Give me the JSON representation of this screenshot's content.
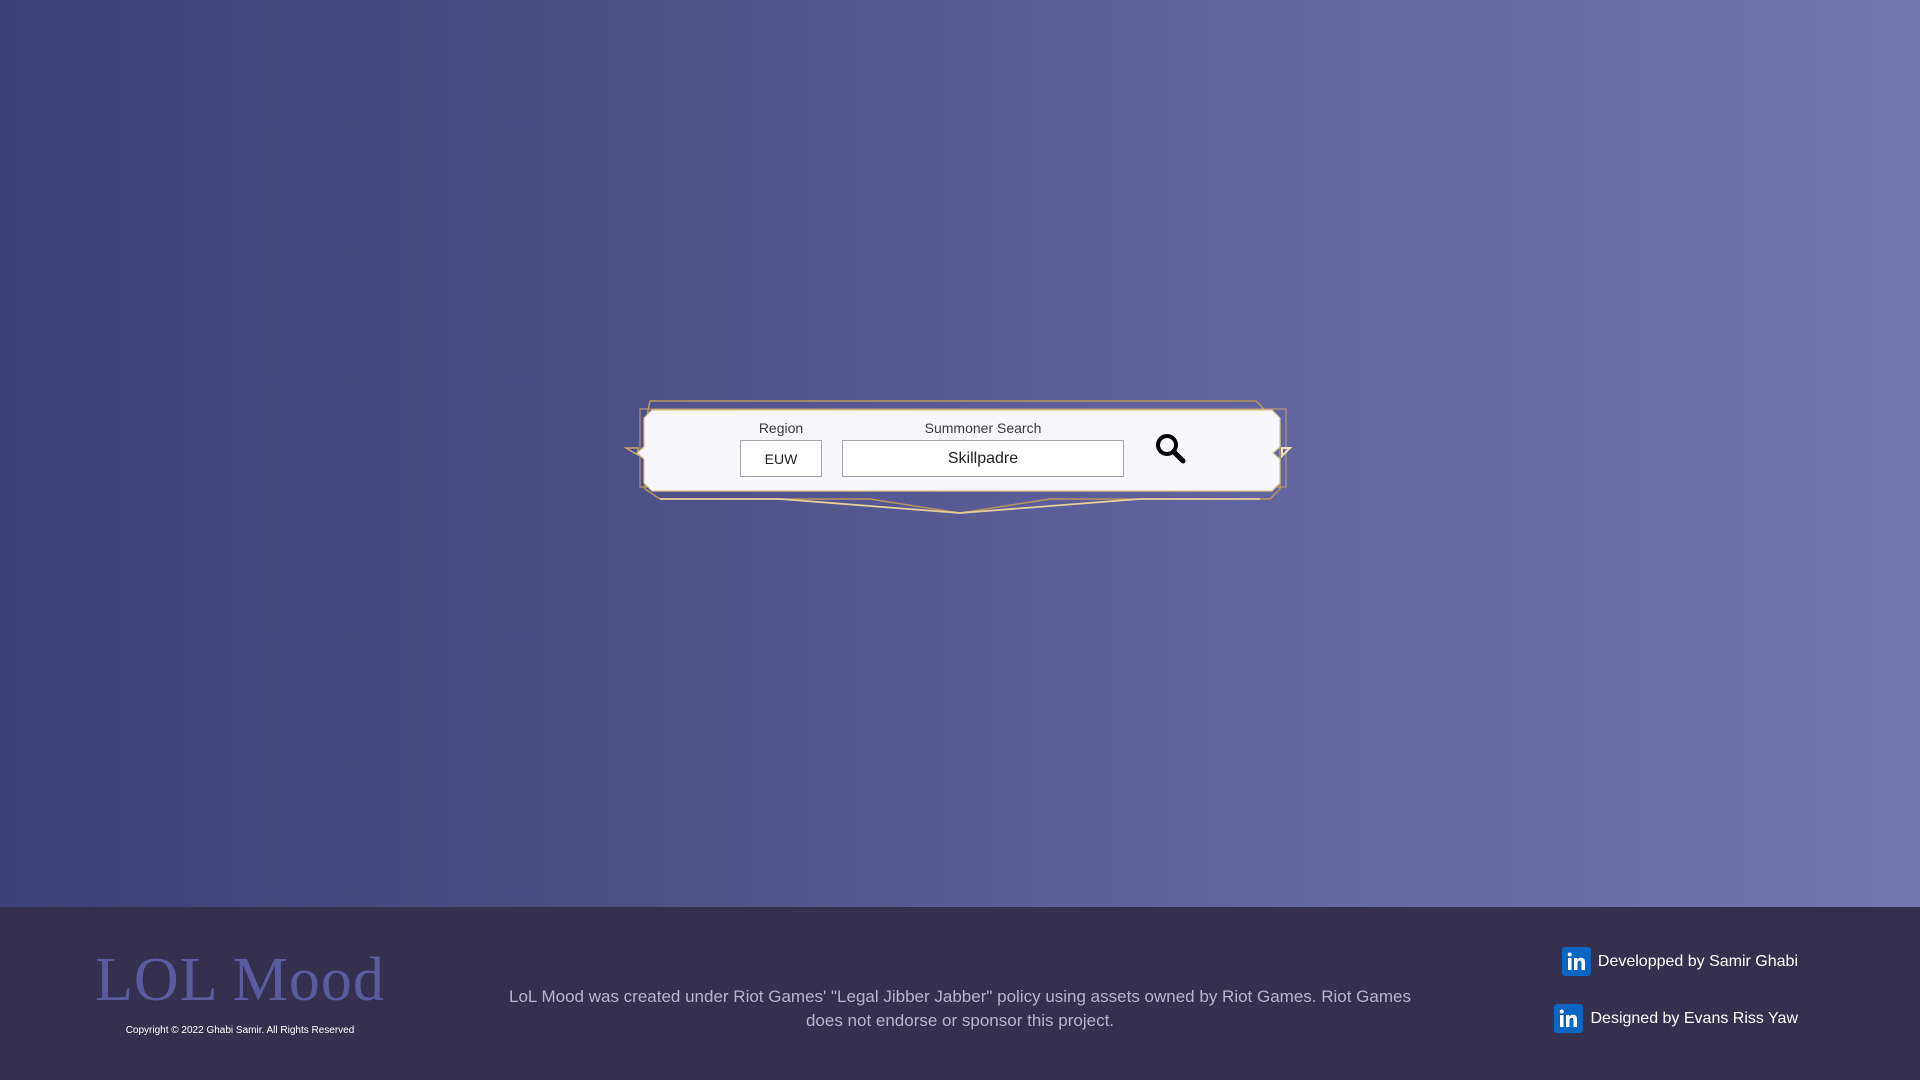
{
  "search": {
    "region_label": "Region",
    "region_value": "EUW",
    "summoner_label": "Summoner Search",
    "summoner_value": "Skillpadre",
    "search_icon": "search-icon"
  },
  "footer": {
    "brand": "LOL Mood",
    "copyright": "Copyright © 2022 Ghabi Samir. All Rights Reserved",
    "disclaimer": "LoL Mood was created under Riot Games' \"Legal Jibber Jabber\" policy using assets owned by Riot Games. Riot Games does not endorse or sponsor this project.",
    "credits": [
      {
        "icon": "linkedin-icon",
        "label": "Developped by Samir Ghabi"
      },
      {
        "icon": "linkedin-icon",
        "label": "Designed by Evans Riss Yaw"
      }
    ]
  },
  "colors": {
    "gradient_start": "#3c3f77",
    "gradient_end": "#7476b2",
    "frame_gold": "#c9a56a",
    "footer_bg": "#34304e",
    "brand": "#5b5ba0",
    "linkedin": "#0a66c2"
  }
}
